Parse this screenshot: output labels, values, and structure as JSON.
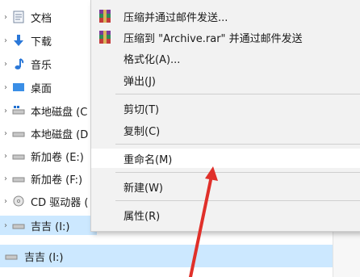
{
  "sidebar": {
    "items": [
      {
        "label": "文档",
        "icon": "documents-icon"
      },
      {
        "label": "下载",
        "icon": "download-icon"
      },
      {
        "label": "音乐",
        "icon": "music-icon"
      },
      {
        "label": "桌面",
        "icon": "desktop-icon"
      },
      {
        "label": "本地磁盘 (C",
        "icon": "drive-icon"
      },
      {
        "label": "本地磁盘 (D",
        "icon": "drive-icon"
      },
      {
        "label": "新加卷 (E:)",
        "icon": "drive-icon"
      },
      {
        "label": "新加卷 (F:)",
        "icon": "drive-icon"
      },
      {
        "label": "CD 驱动器 (",
        "icon": "cd-drive-icon"
      },
      {
        "label": "吉吉 (I:)",
        "icon": "usb-drive-icon"
      }
    ],
    "bottom_item": {
      "label": "吉吉 (I:)",
      "icon": "usb-drive-icon"
    }
  },
  "context_menu": {
    "items": [
      {
        "label": "压缩并通过邮件发送...",
        "icon": "winrar-icon"
      },
      {
        "label": "压缩到 \"Archive.rar\" 并通过邮件发送",
        "icon": "winrar-icon"
      },
      {
        "label": "格式化(A)..."
      },
      {
        "label": "弹出(J)"
      },
      {
        "label": "剪切(T)"
      },
      {
        "label": "复制(C)"
      },
      {
        "label": "重命名(M)"
      },
      {
        "label": "新建(W)"
      },
      {
        "label": "属性(R)"
      }
    ]
  },
  "colors": {
    "selection": "#cce8ff",
    "menu_bg": "#f2f2f2",
    "annotation_arrow": "#e0302a"
  }
}
